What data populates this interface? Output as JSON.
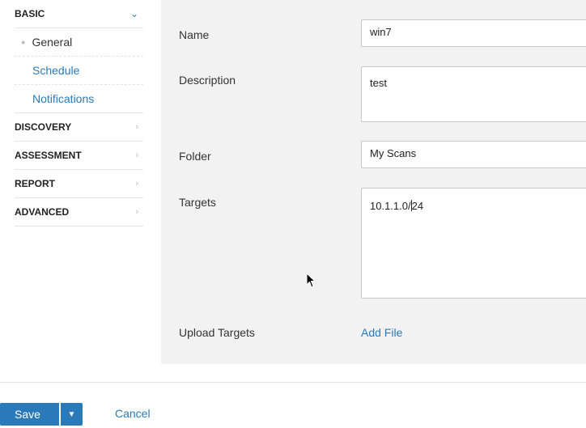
{
  "sidebar": {
    "basic": {
      "label": "BASIC",
      "icon": "chevron-down-icon"
    },
    "basic_items": [
      {
        "label": "General",
        "current": true
      },
      {
        "label": "Schedule"
      },
      {
        "label": "Notifications"
      }
    ],
    "sections": [
      {
        "label": "DISCOVERY",
        "icon": "chevron-right-icon"
      },
      {
        "label": "ASSESSMENT",
        "icon": "chevron-right-icon"
      },
      {
        "label": "REPORT",
        "icon": "chevron-right-icon"
      },
      {
        "label": "ADVANCED",
        "icon": "chevron-right-icon"
      }
    ]
  },
  "form": {
    "name": {
      "label": "Name",
      "value": "win7"
    },
    "description": {
      "label": "Description",
      "value": "test"
    },
    "folder": {
      "label": "Folder",
      "value": "My Scans"
    },
    "targets": {
      "label": "Targets",
      "value_before_caret": "10.1.1.0/",
      "value_after_caret": "24"
    },
    "upload_targets": {
      "label": "Upload Targets",
      "action": "Add File"
    }
  },
  "footer": {
    "save_label": "Save",
    "cancel_label": "Cancel"
  },
  "colors": {
    "accent": "#2a7ab9",
    "panel_bg": "#f2f2f2"
  }
}
